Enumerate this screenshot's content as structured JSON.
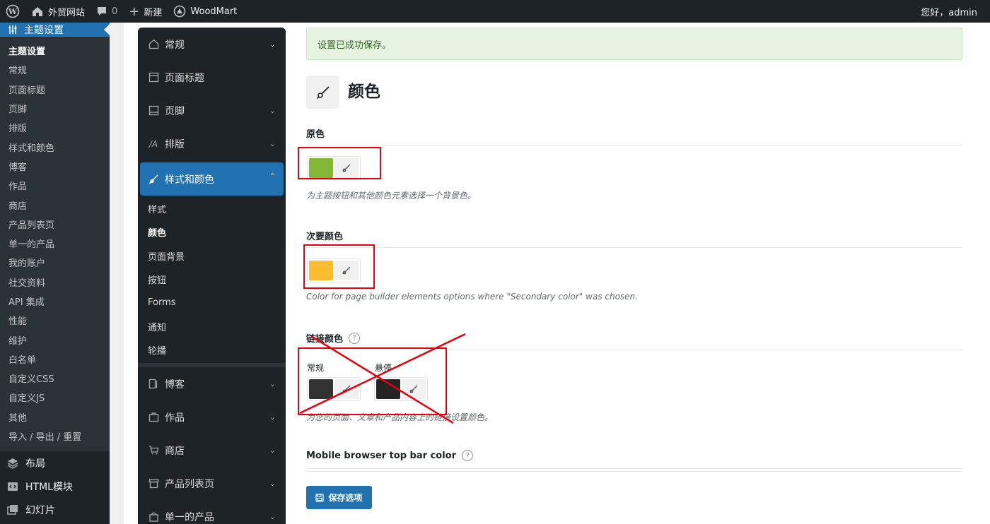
{
  "adminbar": {
    "site_name": "外贸网站",
    "comment_count": "0",
    "new_label": "新建",
    "theme_label": "WoodMart",
    "greeting": "您好，admin"
  },
  "wpmenu": {
    "current_label": "主题设置",
    "sub_items": [
      "主题设置",
      "常规",
      "页面标题",
      "页脚",
      "排版",
      "样式和颜色",
      "博客",
      "作品",
      "商店",
      "产品列表页",
      "单一的产品",
      "我的账户",
      "社交资料",
      "API 集成",
      "性能",
      "维护",
      "白名单",
      "自定义CSS",
      "自定义JS",
      "其他",
      "导入 / 导出 / 重置"
    ],
    "top_items": [
      {
        "label": "布局",
        "icon": "layers-icon"
      },
      {
        "label": "HTML模块",
        "icon": "code-block-icon"
      },
      {
        "label": "幻灯片",
        "icon": "slides-icon"
      }
    ]
  },
  "wdnav": {
    "items_before": [
      {
        "label": "常规",
        "icon": "home-icon"
      },
      {
        "label": "页面标题",
        "icon": "title-icon"
      },
      {
        "label": "页脚",
        "icon": "footer-icon"
      },
      {
        "label": "排版",
        "icon": "typography-icon"
      }
    ],
    "active_item": {
      "label": "样式和颜色",
      "icon": "brush-icon"
    },
    "sub_items": [
      "样式",
      "颜色",
      "页面背景",
      "按钮",
      "Forms",
      "通知",
      "轮播"
    ],
    "items_after": [
      {
        "label": "博客",
        "icon": "blog-icon"
      },
      {
        "label": "作品",
        "icon": "portfolio-icon"
      },
      {
        "label": "商店",
        "icon": "cart-icon"
      },
      {
        "label": "产品列表页",
        "icon": "archive-icon"
      },
      {
        "label": "单一的产品",
        "icon": "bag-icon"
      }
    ]
  },
  "notice": "设置已成功保存。",
  "section_title": "颜色",
  "fields": {
    "primary": {
      "title": "原色",
      "color": "#83b735",
      "desc": "为主题按钮和其他颜色元素选择一个背景色。"
    },
    "secondary": {
      "title": "次要颜色",
      "color": "#fbbc34",
      "desc": "Color for page builder elements options where \"Secondary color\" was chosen."
    },
    "link": {
      "title": "链接颜色",
      "normal_label": "常规",
      "normal_color": "#333333",
      "hover_label": "悬停",
      "hover_color": "#242424",
      "desc": "为您的页面、文章和产品内容上的链接设置颜色。"
    },
    "mobile_bar": {
      "title": "Mobile browser top bar color"
    }
  },
  "save_label": "保存选项"
}
